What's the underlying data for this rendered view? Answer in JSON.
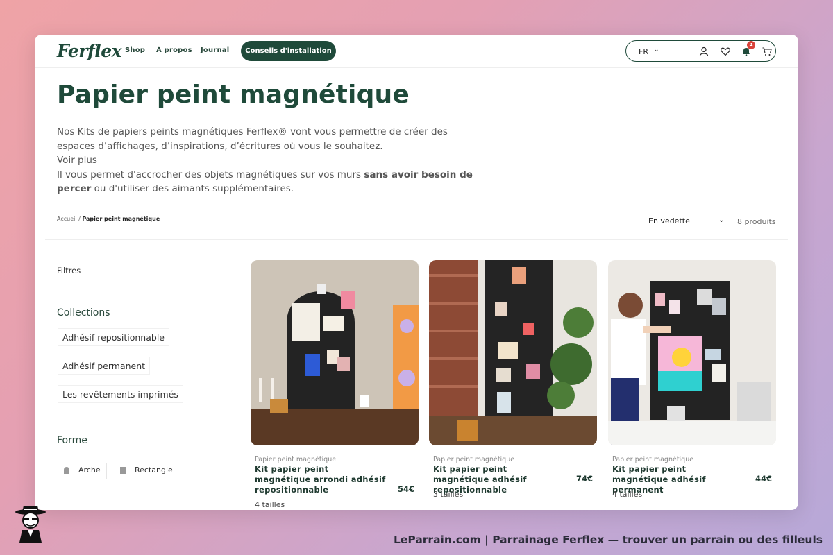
{
  "header": {
    "logo": "Ferflex",
    "nav": [
      "Shop",
      "À propos",
      "Journal"
    ],
    "cta": "Conseils d'installation",
    "lang": "FR",
    "notification_count": "4"
  },
  "page": {
    "title": "Papier peint magnétique",
    "description_1": "Nos Kits de papiers peints magnétiques Ferflex® vont vous permettre de créer des espaces d’affichages, d’inspirations, d’écritures où vous le souhaitez.",
    "see_more": "Voir plus",
    "description_2_start": "Il vous permet d'accrocher des objets magnétiques sur vos murs ",
    "description_2_bold": "sans avoir besoin de percer",
    "description_2_end": " ou d'utiliser des aimants supplémentaires."
  },
  "breadcrumb": {
    "home": "Accueil",
    "separator": "/",
    "current": "Papier peint magnétique"
  },
  "sort": {
    "selected": "En vedette",
    "count": "8 produits"
  },
  "filters": {
    "title": "Filtres",
    "collections_title": "Collections",
    "collections": [
      "Adhésif repositionnable",
      "Adhésif permanent",
      "Les revêtements imprimés"
    ],
    "shape_title": "Forme",
    "shapes": [
      "Arche",
      "Rectangle"
    ]
  },
  "products": [
    {
      "category": "Papier peint magnétique",
      "name": "Kit papier peint magnétique arrondi adhésif repositionnable",
      "price": "54€",
      "sizes": "4 tailles"
    },
    {
      "category": "Papier peint magnétique",
      "name": "Kit papier peint magnétique adhésif repositionnable",
      "price": "74€",
      "sizes": "3 tailles"
    },
    {
      "category": "Papier peint magnétique",
      "name": "Kit papier peint magnétique adhésif permanent",
      "price": "44€",
      "sizes": "4 tailles"
    }
  ],
  "footer": {
    "text": "LeParrain.com | Parrainage Ferflex — trouver un parrain ou des filleuls"
  },
  "colors": {
    "brand_green": "#1f4a3a",
    "badge_red": "#d9433a"
  }
}
